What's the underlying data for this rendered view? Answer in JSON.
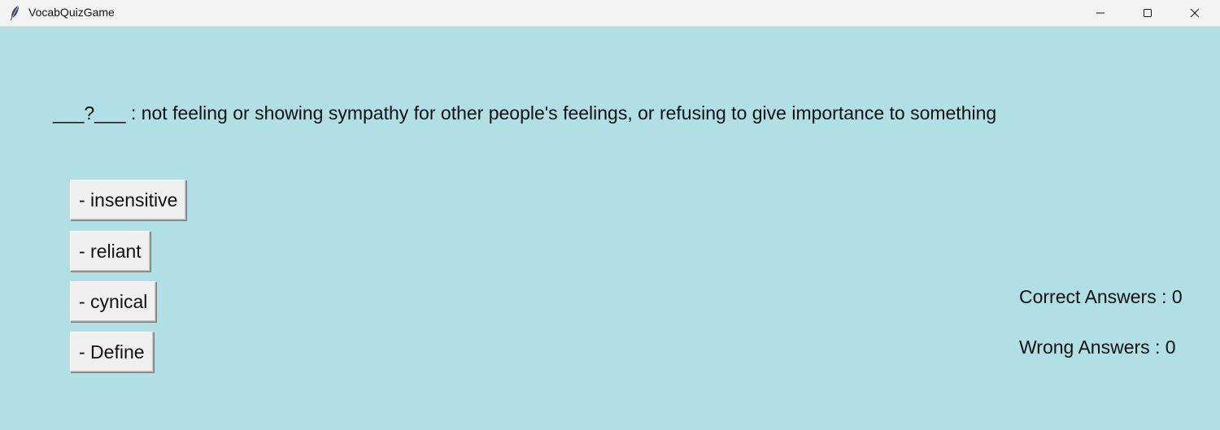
{
  "window": {
    "title": "VocabQuizGame",
    "app_icon": "feather-icon",
    "background_color": "#b0dfe5"
  },
  "question": {
    "text": "___?___ : not feeling or showing sympathy for other people's feelings, or refusing to give importance to something"
  },
  "options": [
    {
      "label": "- insensitive"
    },
    {
      "label": "- reliant"
    },
    {
      "label": "- cynical"
    },
    {
      "label": "- Define"
    }
  ],
  "score": {
    "correct_label": "Correct Answers : 0",
    "wrong_label": "Wrong Answers : 0",
    "correct": 0,
    "wrong": 0
  }
}
